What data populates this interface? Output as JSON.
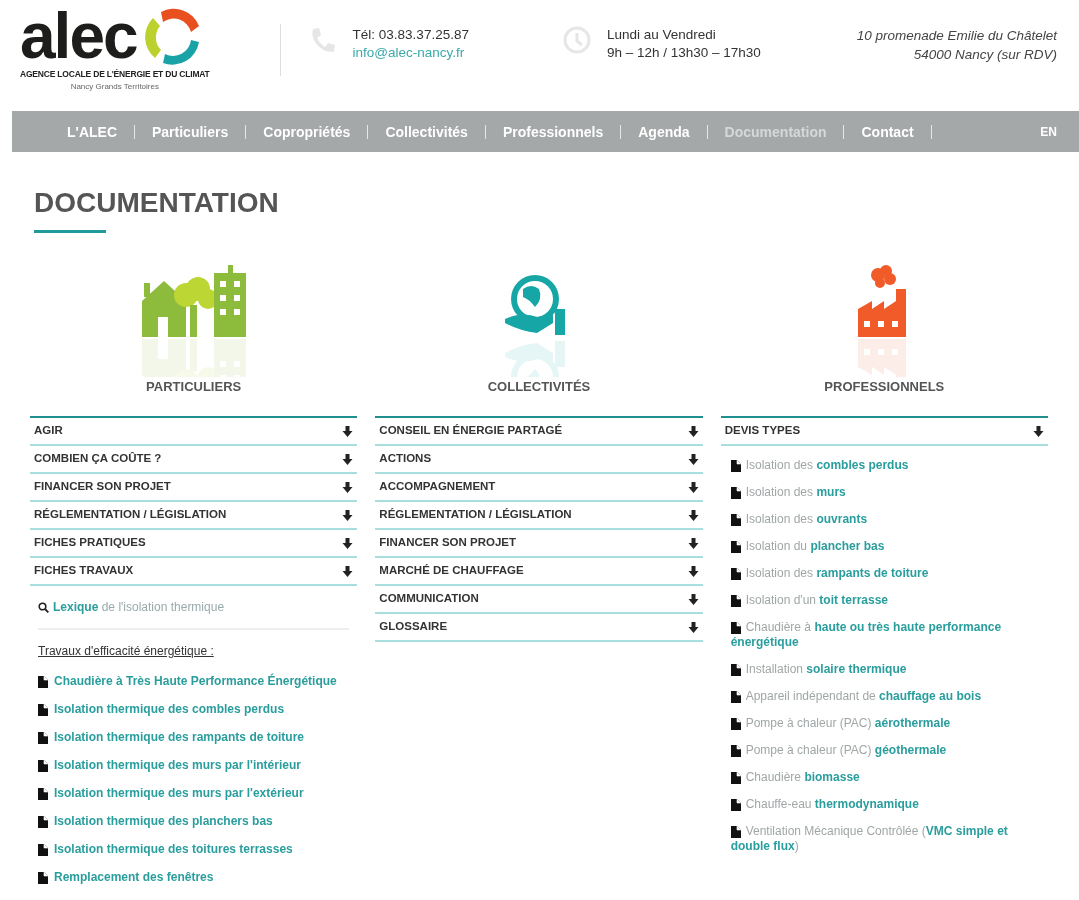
{
  "header": {
    "logo": {
      "wordmark": "alec",
      "tagline": "AGENCE LOCALE DE L'ÉNERGIE ET DU CLIMAT",
      "subtitle": "Nancy Grands Territoires"
    },
    "phone": "Tél: 03.83.37.25.87",
    "email": "info@alec-nancy.fr",
    "hours": [
      "Lundi au Vendredi",
      "9h – 12h / 13h30 – 17h30"
    ],
    "address": [
      "10 promenade Emilie du Châtelet",
      "54000 Nancy (sur RDV)"
    ]
  },
  "nav": {
    "items": [
      {
        "label": "L'ALEC",
        "selected": false
      },
      {
        "label": "Particuliers",
        "selected": false
      },
      {
        "label": "Copropriétés",
        "selected": false
      },
      {
        "label": "Collectivités",
        "selected": false
      },
      {
        "label": "Professionnels",
        "selected": false
      },
      {
        "label": "Agenda",
        "selected": false
      },
      {
        "label": "Documentation",
        "selected": true
      },
      {
        "label": "Contact",
        "selected": false
      }
    ],
    "language": "EN"
  },
  "page_title": "DOCUMENTATION",
  "columns": [
    {
      "title": "PARTICULIERS",
      "sections": [
        "AGIR",
        "COMBIEN ÇA COÛTE ?",
        "FINANCER SON PROJET",
        "RÉGLEMENTATION / LÉGISLATION",
        "FICHES PRATIQUES",
        "FICHES TRAVAUX"
      ],
      "lexicon_link": "**Lexique** de l'isolation thermique",
      "list_heading": "Travaux d'efficacité énergétique :",
      "documents": [
        "Chaudière à Très Haute Performance Énergétique",
        "Isolation thermique des combles perdus",
        "Isolation thermique des rampants de toiture",
        "Isolation thermique des murs par l'intérieur",
        "Isolation thermique des murs par l'extérieur",
        "Isolation thermique des planchers bas",
        "Isolation thermique des toitures terrasses",
        "Remplacement des fenêtres"
      ]
    },
    {
      "title": "COLLECTIVITÉS",
      "sections": [
        "CONSEIL EN ÉNERGIE PARTAGÉ",
        "ACTIONS",
        "ACCOMPAGNEMENT",
        "RÉGLEMENTATION / LÉGISLATION",
        "FINANCER SON PROJET",
        "MARCHÉ DE CHAUFFAGE",
        "COMMUNICATION",
        "GLOSSAIRE"
      ]
    },
    {
      "title": "PROFESSIONNELS",
      "sections": [
        "DEVIS TYPES"
      ],
      "documents": [
        "Isolation des **combles perdus**",
        "Isolation des **murs**",
        "Isolation des **ouvrants**",
        "Isolation du **plancher bas**",
        "Isolation des **rampants de toiture**",
        "Isolation d'un **toit terrasse**",
        "Chaudière à **haute ou très haute performance énergétique**",
        "Installation **solaire thermique**",
        "Appareil indépendant de **chauffage au bois**",
        "Pompe à chaleur (PAC) **aérothermale**",
        "Pompe à chaleur (PAC) **géothermale**",
        "Chaudière **biomasse**",
        "Chauffe-eau **thermodynamique**",
        "Ventilation Mécanique Contrôlée (**VMC simple et double flux**)"
      ]
    }
  ]
}
